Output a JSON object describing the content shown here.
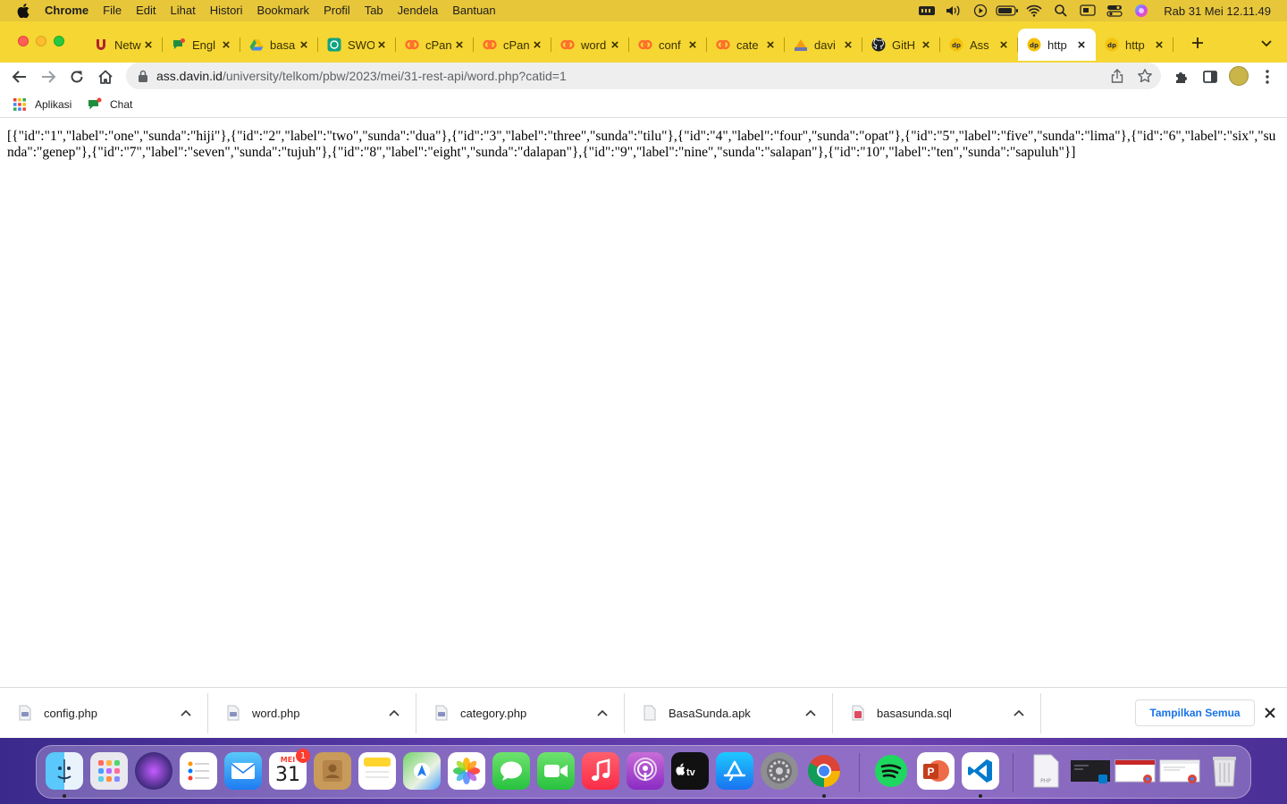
{
  "menubar": {
    "app_name": "Chrome",
    "items": [
      "File",
      "Edit",
      "Lihat",
      "Histori",
      "Bookmark",
      "Profil",
      "Tab",
      "Jendela",
      "Bantuan"
    ],
    "clock": "Rab 31 Mei  12.11.49"
  },
  "tabs": [
    {
      "label": "Netw",
      "icon": "telkom-u-icon"
    },
    {
      "label": "Engl",
      "icon": "chat-icon"
    },
    {
      "label": "basa",
      "icon": "google-drive-icon"
    },
    {
      "label": "SWO",
      "icon": "openai-icon"
    },
    {
      "label": "cPan",
      "icon": "cpanel-icon"
    },
    {
      "label": "cPan",
      "icon": "cpanel-icon"
    },
    {
      "label": "word",
      "icon": "cpanel-icon"
    },
    {
      "label": "conf",
      "icon": "cpanel-icon"
    },
    {
      "label": "cate",
      "icon": "cpanel-icon"
    },
    {
      "label": "davi",
      "icon": "pma-icon"
    },
    {
      "label": "GitH",
      "icon": "github-icon"
    },
    {
      "label": "Ass",
      "icon": "dp-icon"
    },
    {
      "label": "http",
      "icon": "dp-icon",
      "active": true
    },
    {
      "label": "http",
      "icon": "dp-icon"
    }
  ],
  "omnibox": {
    "host": "ass.davin.id",
    "path": "/university/telkom/pbw/2023/mei/31-rest-api/word.php?catid=1"
  },
  "bookmarks": [
    {
      "label": "Aplikasi",
      "icon": "apps-grid-icon"
    },
    {
      "label": "Chat",
      "icon": "chat-icon"
    }
  ],
  "content": {
    "json_text": "[{\"id\":\"1\",\"label\":\"one\",\"sunda\":\"hiji\"},{\"id\":\"2\",\"label\":\"two\",\"sunda\":\"dua\"},{\"id\":\"3\",\"label\":\"three\",\"sunda\":\"tilu\"},{\"id\":\"4\",\"label\":\"four\",\"sunda\":\"opat\"},{\"id\":\"5\",\"label\":\"five\",\"sunda\":\"lima\"},{\"id\":\"6\",\"label\":\"six\",\"sunda\":\"genep\"},{\"id\":\"7\",\"label\":\"seven\",\"sunda\":\"tujuh\"},{\"id\":\"8\",\"label\":\"eight\",\"sunda\":\"dalapan\"},{\"id\":\"9\",\"label\":\"nine\",\"sunda\":\"salapan\"},{\"id\":\"10\",\"label\":\"ten\",\"sunda\":\"sapuluh\"}]"
  },
  "downloads": {
    "items": [
      {
        "name": "config.php",
        "type": "php"
      },
      {
        "name": "word.php",
        "type": "php"
      },
      {
        "name": "category.php",
        "type": "php"
      },
      {
        "name": "BasaSunda.apk",
        "type": "apk"
      },
      {
        "name": "basasunda.sql",
        "type": "sql"
      }
    ],
    "show_all_label": "Tampilkan Semua"
  },
  "dock": {
    "calendar_month": "MEI",
    "calendar_day": "31",
    "calendar_badge": "1",
    "apps": [
      "finder",
      "launchpad",
      "siri",
      "reminders",
      "mail",
      "calendar",
      "contacts",
      "notes",
      "maps",
      "photos",
      "messages",
      "facetime",
      "music",
      "podcasts",
      "tv",
      "app-store",
      "system-preferences",
      "chrome",
      "spotify",
      "powerpoint",
      "vscode",
      "php-file",
      "terminal-window",
      "chrome-window",
      "chrome-window-2",
      "trash"
    ]
  },
  "colors": {
    "tabstrip": "#f5d633",
    "menubar": "#e8c63a",
    "link_blue": "#1a73e8"
  }
}
